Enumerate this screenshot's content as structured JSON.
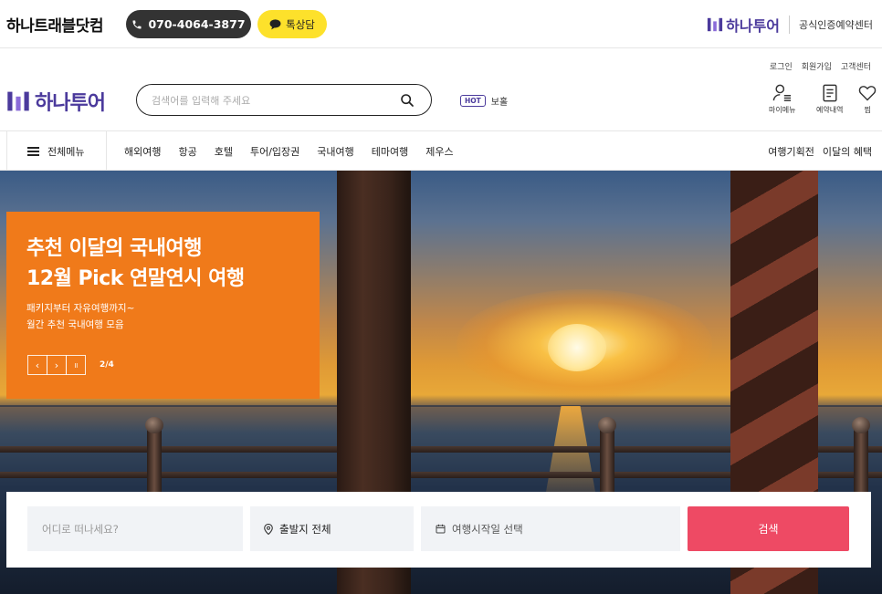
{
  "topbar": {
    "site_name": "하나트래블닷컴",
    "phone": "070-4064-3877",
    "chat": "톡상담",
    "partner_logo": "하나투어",
    "partner_desc": "공식인증예약센터"
  },
  "header": {
    "util_links": [
      "로그인",
      "회원가입",
      "고객센터"
    ],
    "logo": "하나투어",
    "search_placeholder": "검색어를 입력해 주세요",
    "hot_tag": "HOT",
    "hot_keyword": "보홀",
    "quick_links": [
      {
        "label": "마이메뉴",
        "icon": "user-list-icon"
      },
      {
        "label": "예약내역",
        "icon": "document-icon"
      },
      {
        "label": "찜",
        "icon": "heart-icon"
      }
    ]
  },
  "nav": {
    "all_menu": "전체메뉴",
    "items": [
      "해외여행",
      "항공",
      "호텔",
      "투어/입장권",
      "국내여행",
      "테마여행",
      "제우스"
    ],
    "right_items": [
      "여행기획전",
      "이달의 혜택"
    ]
  },
  "hero": {
    "title_line1": "추천 이달의 국내여행",
    "title_line2": "12월 Pick 연말연시 여행",
    "desc_line1": "패키지부터 자유여행까지~",
    "desc_line2": "월간 추천 국내여행 모음",
    "counter": "2/4",
    "controls": {
      "prev": "‹",
      "next": "›",
      "pause": "॥"
    }
  },
  "search_panel": {
    "destination_placeholder": "어디로 떠나세요?",
    "origin": "출발지 전체",
    "date": "여행시작일 선택",
    "button": "검색"
  },
  "colors": {
    "brand": "#4b3a9c",
    "promo": "#f07a1a",
    "search_button": "#ee4a64",
    "chat_button": "#fde12b"
  }
}
